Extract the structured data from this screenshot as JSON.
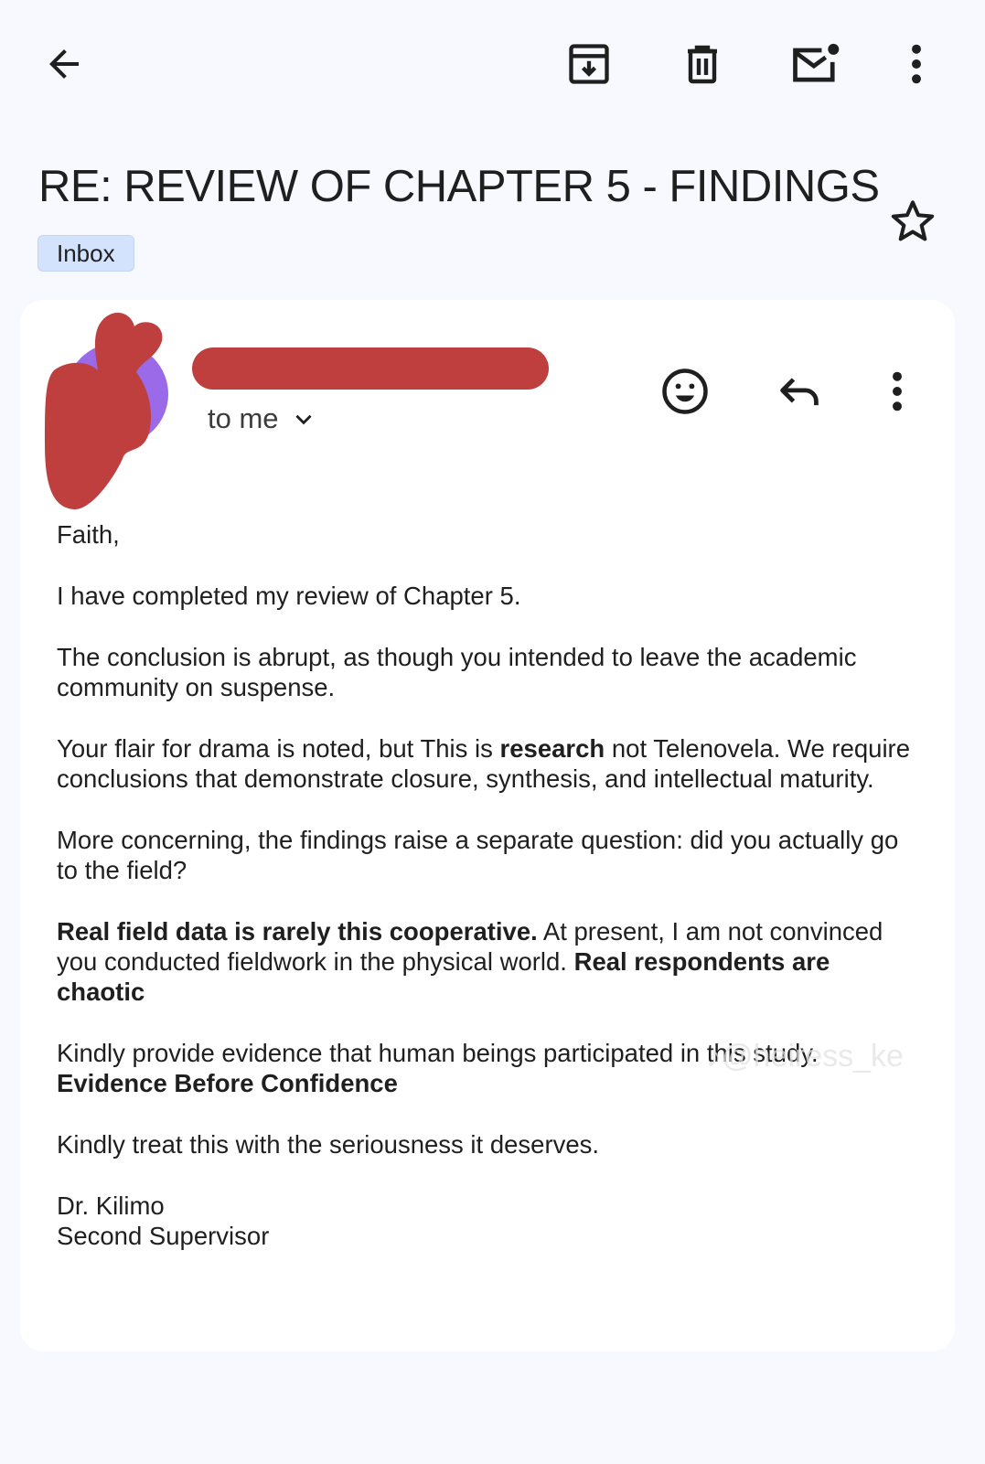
{
  "toolbar": {
    "back_icon": "arrow-left-icon",
    "archive_icon": "archive-icon",
    "delete_icon": "trash-icon",
    "unread_icon": "mark-unread-icon",
    "more_icon": "more-vert-icon"
  },
  "email": {
    "subject": "RE: REVIEW OF CHAPTER 5 - FINDINGS",
    "label": "Inbox",
    "star_icon": "star-outline-icon",
    "recipient": "to me",
    "chevron_icon": "chevron-down-icon",
    "actions": {
      "react_icon": "emoji-icon",
      "reply_icon": "reply-icon",
      "more_icon": "more-vert-icon"
    },
    "greeting": "Faith,",
    "p1": "I have completed my review of Chapter 5.",
    "p2": "The conclusion is abrupt, as though you intended to leave the academic community on suspense.",
    "p3_a": "Your flair for drama is noted, but This is ",
    "p3_bold": "research",
    "p3_b": " not Telenovela. We require conclusions that demonstrate closure, synthesis, and intellectual maturity.",
    "p4": "More concerning, the findings raise a separate question: did you actually go to the field?",
    "p5_bold1": "Real field data is rarely this cooperative.",
    "p5_a": " At present, I am not convinced you conducted fieldwork in the physical world. ",
    "p5_bold2": "Real respondents are chaotic",
    "p6_a": "Kindly provide evidence that human beings participated in this study.",
    "p6_bold": "Evidence Before Confidence",
    "p7": "Kindly treat this with the seriousness it deserves.",
    "sig_name": "Dr. Kilimo",
    "sig_title": "Second Supervisor"
  },
  "watermark": "♪@heiress_ke",
  "colors": {
    "background": "#f7f9fe",
    "card": "#ffffff",
    "chip": "#d3e3fd",
    "redaction": "#bf3f3f",
    "avatar": "#9a6ae9"
  }
}
